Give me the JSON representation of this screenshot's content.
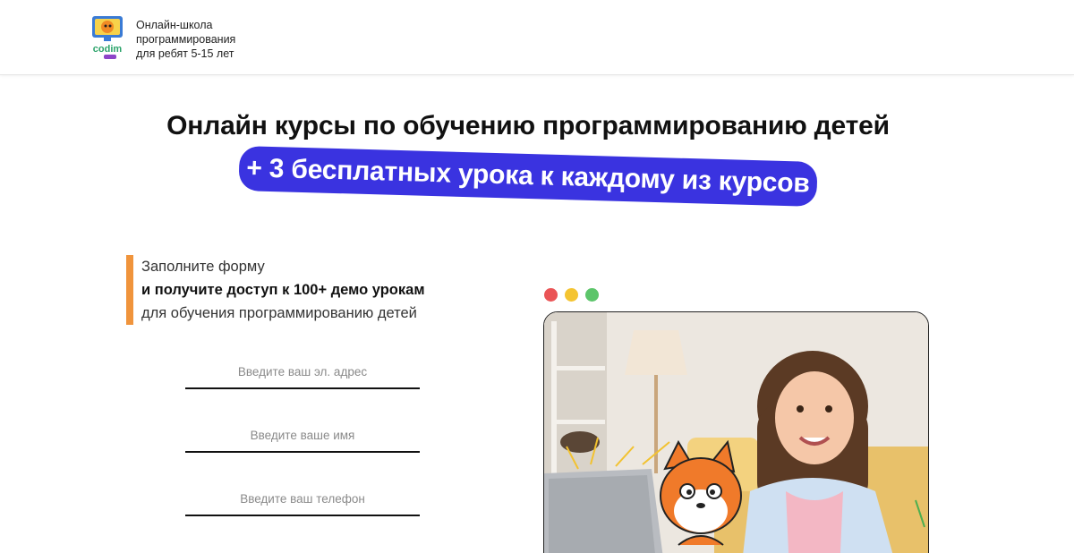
{
  "header": {
    "logo_text": "codim",
    "brand_lines": [
      "Онлайн-школа",
      "программирования",
      "для ребят 5-15 лет"
    ]
  },
  "hero": {
    "title": "Онлайн курсы по обучению программированию детей",
    "promo": "+ 3 бесплатных урока к каждому из курсов"
  },
  "intro": {
    "line1": "Заполните форму",
    "line2": "и получите доступ к 100+ демо урокам",
    "line3": "для обучения программированию детей"
  },
  "form": {
    "email_placeholder": "Введите ваш эл. адрес",
    "name_placeholder": "Введите ваше имя",
    "phone_placeholder": "Введите ваш телефон"
  },
  "colors": {
    "accent_blue": "#3a33e0",
    "accent_orange": "#f0943c",
    "dot_red": "#ea5456",
    "dot_yellow": "#f4c431",
    "dot_green": "#5cc56a"
  }
}
